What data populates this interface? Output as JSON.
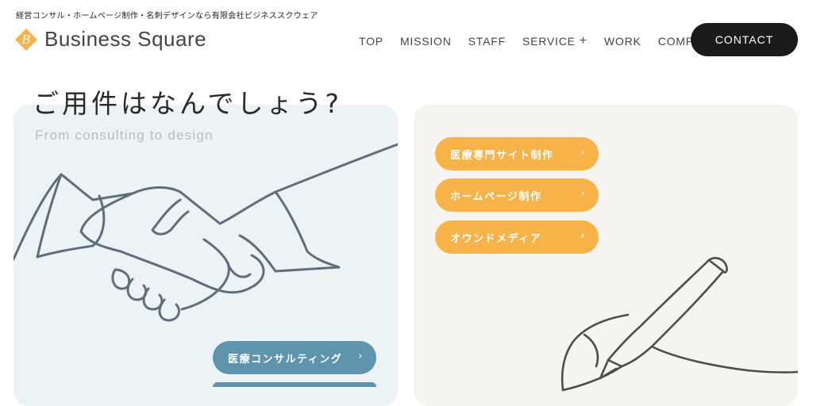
{
  "header": {
    "tagline": "経営コンサル・ホームページ制作・名刺デザインなら有限会社ビジネススクウェア",
    "logo_text": "Business Square",
    "logo_letter": "B",
    "nav": [
      "TOP",
      "MISSION",
      "STAFF",
      "SERVICE",
      "WORK",
      "COMPANY"
    ],
    "service_plus": "+",
    "contact": "CONTACT"
  },
  "hero": {
    "title": "ご用件はなんでしょう?",
    "subtitle": "From consulting to design"
  },
  "services_left": {
    "buttons": [
      "医療コンサルティング"
    ]
  },
  "services_right": {
    "buttons": [
      "医療専門サイト制作",
      "ホームページ制作",
      "オウンドメディア"
    ]
  },
  "chevron": "›",
  "colors": {
    "orange": "#f8b348",
    "blue": "#5e94ad",
    "dark": "#1b1b1b",
    "card_left_bg": "#ebf3f4",
    "card_right_bg": "#f5f4f1"
  }
}
